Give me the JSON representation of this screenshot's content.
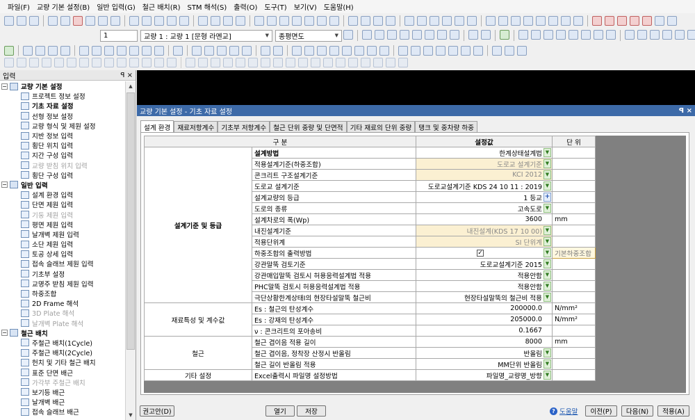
{
  "menu": [
    "파일(F)",
    "교량 기본 설정(B)",
    "일반 입력(G)",
    "철근 배치(R)",
    "STM 해석(S)",
    "출력(O)",
    "도구(T)",
    "보기(V)",
    "도움말(H)"
  ],
  "toolbar": {
    "page_number": "1",
    "bridge_select": "교량 1 : 교량 1 [문형 라멘교]",
    "view_select": "종평면도"
  },
  "panel": {
    "title": "입력",
    "pin": "ꟼ ×",
    "groups": [
      {
        "label": "교량 기본 설정",
        "items": [
          {
            "label": "프로젝트 정보 설정",
            "state": "normal"
          },
          {
            "label": "기초 자료 설정",
            "state": "bold"
          },
          {
            "label": "선형 정보 설정",
            "state": "normal"
          },
          {
            "label": "교량 형식 및 제원 설정",
            "state": "normal"
          },
          {
            "label": "지반 정보 입력",
            "state": "normal"
          },
          {
            "label": "횡단 위치 입력",
            "state": "normal"
          },
          {
            "label": "지간 구성 입력",
            "state": "normal"
          },
          {
            "label": "교량 받침 위치 입력",
            "state": "disabled"
          },
          {
            "label": "횡단 구성 입력",
            "state": "normal"
          }
        ]
      },
      {
        "label": "일반 입력",
        "items": [
          {
            "label": "설계 환경 입력",
            "state": "normal"
          },
          {
            "label": "단면 제원 입력",
            "state": "normal"
          },
          {
            "label": "기둥 제원 입력",
            "state": "disabled"
          },
          {
            "label": "평면 제원 입력",
            "state": "normal"
          },
          {
            "label": "날개벽 제원 입력",
            "state": "normal"
          },
          {
            "label": "소단 제원 입력",
            "state": "normal"
          },
          {
            "label": "토공 상세 입력",
            "state": "normal"
          },
          {
            "label": "접속 슬래브 제원 입력",
            "state": "normal"
          },
          {
            "label": "기초부 설정",
            "state": "normal"
          },
          {
            "label": "교명주 받침 제원 입력",
            "state": "normal"
          },
          {
            "label": "하중조합",
            "state": "normal"
          },
          {
            "label": "2D Frame 해석",
            "state": "normal"
          },
          {
            "label": "3D Plate 해석",
            "state": "disabled"
          },
          {
            "label": "날개벽 Plate 해석",
            "state": "disabled"
          }
        ]
      },
      {
        "label": "철근 배치",
        "items": [
          {
            "label": "주철근 배치(1Cycle)",
            "state": "normal"
          },
          {
            "label": "주철근 배치(2Cycle)",
            "state": "normal"
          },
          {
            "label": "헌치 및 기타 철근 배치",
            "state": "normal"
          },
          {
            "label": "표준 단면 배근",
            "state": "normal"
          },
          {
            "label": "가각부 주철근 배치",
            "state": "disabled"
          },
          {
            "label": "보기등 배근",
            "state": "normal"
          },
          {
            "label": "날개벽 배근",
            "state": "normal"
          },
          {
            "label": "접속 슬래브 배근",
            "state": "normal"
          }
        ]
      }
    ]
  },
  "dialog": {
    "title": "교량 기본 설정 - 기초 자료 설정",
    "title_controls": "ꟼ ×",
    "tabs": [
      "설계 환경",
      "재료저항계수",
      "기초부 저항계수",
      "철근 단위 중량 및 단면적",
      "기타 재료의 단위 중량",
      "탱크 및 중차량 하중"
    ],
    "active_tab": 0,
    "grid": {
      "headers": [
        "구 분",
        "설정값",
        "단 위"
      ],
      "categories": [
        "설계기준 및 등급",
        "재료특성 및 계수값",
        "철근",
        "기타 설정"
      ],
      "rows": [
        {
          "label": "설계방법",
          "value": "한계상태설계법",
          "unit": "",
          "style": "boldlabel",
          "ctl": "dd"
        },
        {
          "label": "적용설계기준(하중조합)",
          "value": "도로교 설계기준",
          "unit": "",
          "style": "cream",
          "ctl": "dd"
        },
        {
          "label": "콘크리트 구조설계기준",
          "value": "KCI 2012",
          "unit": "",
          "style": "cream",
          "ctl": "dd"
        },
        {
          "label": "도로교 설계기준",
          "value": "도로교설계기준 KDS 24 10 11 : 2019",
          "unit": "",
          "style": "",
          "ctl": "dd"
        },
        {
          "label": "설계교량의 등급",
          "value": "1 등교",
          "unit": "",
          "style": "",
          "ctl": "plus"
        },
        {
          "label": "도로의 종류",
          "value": "고속도로",
          "unit": "",
          "style": "",
          "ctl": "dd"
        },
        {
          "label": "설계차로의 폭(Wp)",
          "value": "3600",
          "unit": "mm",
          "style": "",
          "ctl": ""
        },
        {
          "label": "내진설계기준",
          "value": "내진설계(KDS 17 10 00)",
          "unit": "",
          "style": "cream",
          "ctl": "dd"
        },
        {
          "label": "적용단위계",
          "value": "SI 단위계",
          "unit": "",
          "style": "cream",
          "ctl": "dd"
        },
        {
          "label": "하중조합의 출력방법",
          "value": "✓",
          "unit": "기본하중조합",
          "style": "check",
          "ctl": "dd"
        },
        {
          "label": "강관말뚝 검토기준",
          "value": "도로교설계기준 2015",
          "unit": "",
          "style": "",
          "ctl": "dd"
        },
        {
          "label": "강관매입말뚝 검토시 허용응력설계법 적용",
          "value": "적용안함",
          "unit": "",
          "style": "",
          "ctl": "dd"
        },
        {
          "label": "PHC말뚝 검토시 허용응력설계법 적용",
          "value": "적용안함",
          "unit": "",
          "style": "",
          "ctl": "dd"
        },
        {
          "label": "극단상황한계상태Ⅰ의 현장타설말뚝 철근비",
          "value": "현장타설말뚝의 철근비 적용",
          "unit": "",
          "style": "",
          "ctl": "dd"
        },
        {
          "label": "Es : 철근의 탄성계수",
          "value": "200000.0",
          "unit": "N/mm²",
          "style": "",
          "ctl": ""
        },
        {
          "label": "Es : 강재의 탄성계수",
          "value": "205000.0",
          "unit": "N/mm²",
          "style": "",
          "ctl": ""
        },
        {
          "label": "ν : 콘크리트의 포아송비",
          "value": "0.1667",
          "unit": "",
          "style": "",
          "ctl": ""
        },
        {
          "label": "철근 겹이음 적용 길이",
          "value": "8000",
          "unit": "mm",
          "style": "",
          "ctl": ""
        },
        {
          "label": "철근 겹이음, 정착장 산정시 반올림",
          "value": "반올림",
          "unit": "",
          "style": "",
          "ctl": "dd"
        },
        {
          "label": "철근 길이 반올림 적용",
          "value": "MM단위 반올림",
          "unit": "",
          "style": "",
          "ctl": "dd"
        },
        {
          "label": "Excel출력시 파일명 설정방법",
          "value": "파일명_교량명_방향",
          "unit": "",
          "style": "",
          "ctl": "dd"
        }
      ]
    },
    "buttons": {
      "recommend": "권고안(D)",
      "open": "열기",
      "save": "저장",
      "help": "도움말",
      "prev": "이전(P)",
      "next": "다음(N)",
      "apply": "적용(A)"
    }
  }
}
